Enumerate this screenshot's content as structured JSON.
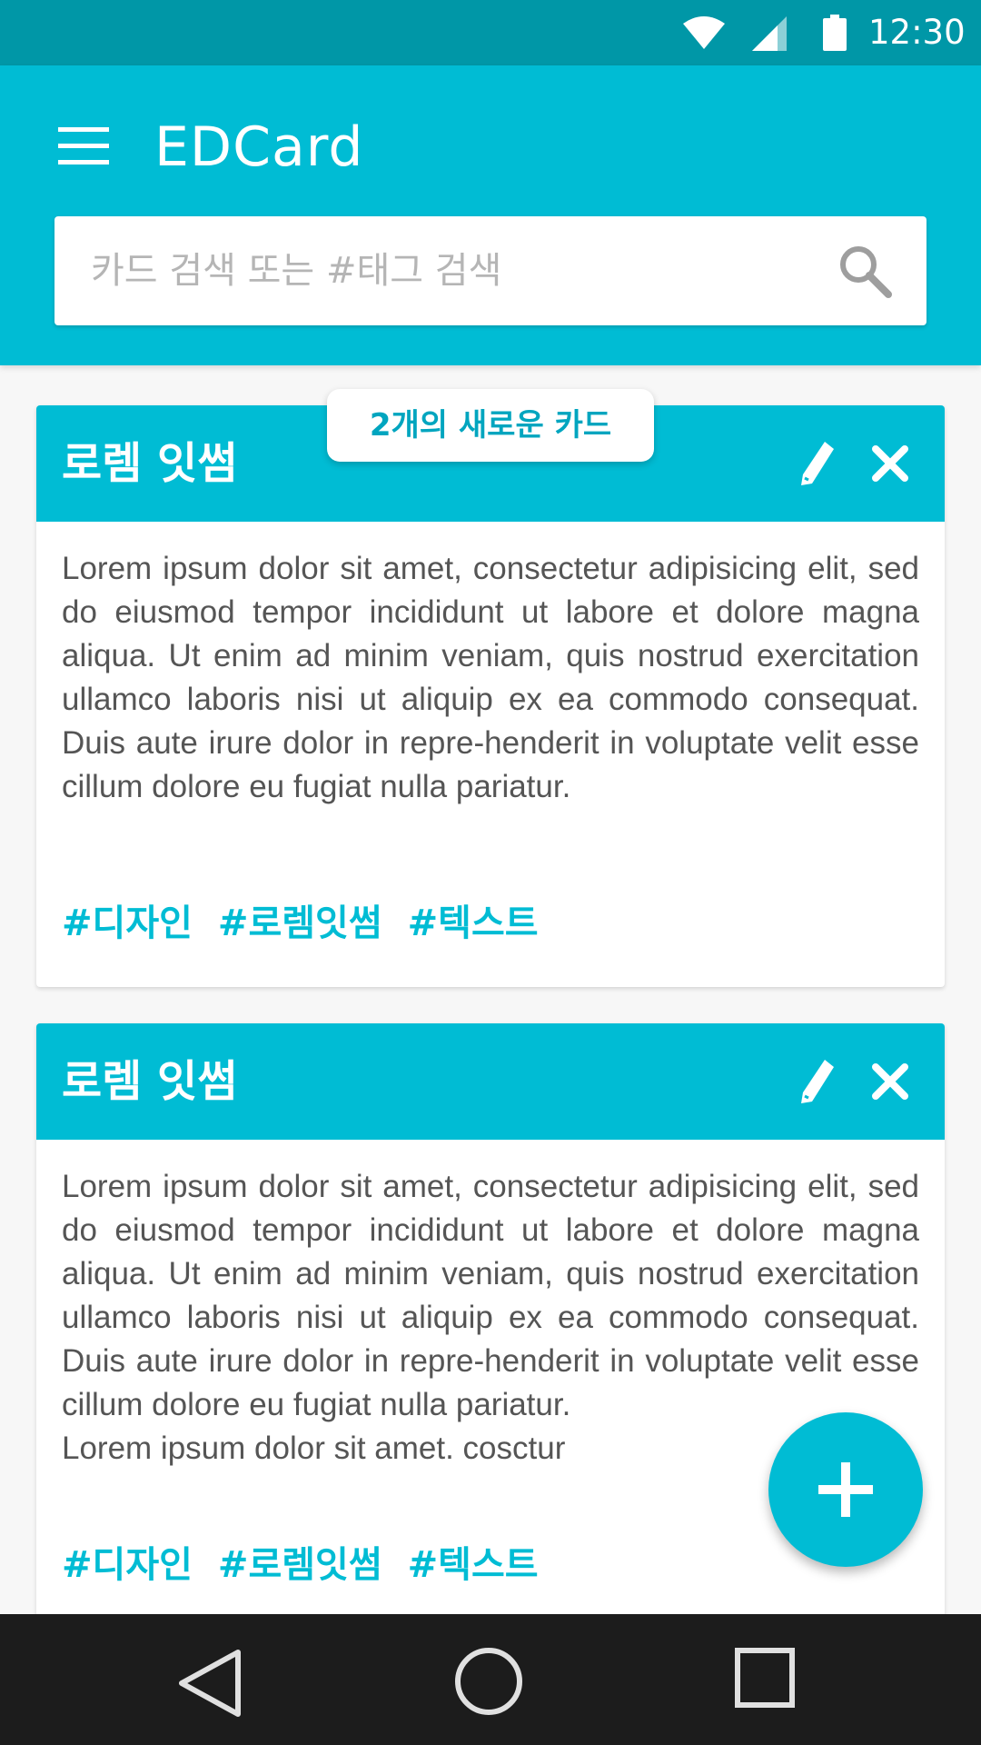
{
  "status_bar": {
    "time": "12:30",
    "icons": [
      "wifi-icon",
      "signal-icon",
      "battery-icon"
    ]
  },
  "app_bar": {
    "title": "EDCard",
    "menu_icon": "hamburger-menu-icon",
    "search": {
      "placeholder": "카드 검색 또는 #태그 검색",
      "value": "",
      "icon": "search-icon"
    }
  },
  "new_cards_notice": "2개의 새로운 카드",
  "cards": [
    {
      "title": "로렘 잇썸",
      "body": "Lorem ipsum dolor sit amet, consectetur adipisicing elit, sed do eiusmod tempor incididunt ut labore et dolore magna aliqua. Ut enim ad minim veniam, quis nostrud exercitation ullamco laboris nisi ut aliquip ex ea commodo consequat. Duis aute irure dolor in repre-henderit in voluptate velit esse cillum dolore eu fugiat nulla pariatur.",
      "extra": "",
      "tags": [
        "#디자인",
        "#로렘잇썸",
        "#텍스트"
      ]
    },
    {
      "title": "로렘 잇썸",
      "body": "Lorem ipsum dolor sit amet, consectetur adipisicing elit, sed do eiusmod tempor incididunt ut labore et dolore magna aliqua. Ut enim ad minim veniam, quis nostrud exercitation ullamco laboris nisi ut aliquip ex ea commodo consequat. Duis aute irure dolor in repre-henderit in voluptate velit esse cillum dolore eu fugiat nulla pariatur.",
      "extra": "Lorem ipsum dolor sit amet. cosctur",
      "tags": [
        "#디자인",
        "#로렘잇썸",
        "#텍스트"
      ]
    }
  ],
  "fab_icon": "plus-icon",
  "nav_bar": {
    "icons": [
      "back-icon",
      "home-icon",
      "recents-icon"
    ]
  },
  "colors": {
    "primary": "#00bcd4",
    "primary_dark": "#0097a7",
    "background": "#f7f7f7",
    "nav_bar": "#1c1c1c",
    "body_text": "#555555"
  }
}
